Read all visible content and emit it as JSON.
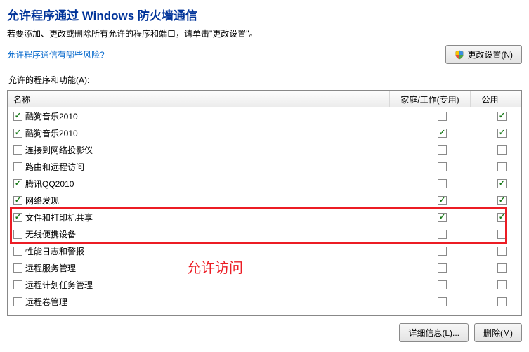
{
  "title": "允许程序通过 Windows 防火墙通信",
  "subtitle": "若要添加、更改或删除所有允许的程序和端口，请单击\"更改设置\"。",
  "risk_link": "允许程序通信有哪些风险?",
  "change_settings_btn": "更改设置(N)",
  "section_label": "允许的程序和功能(A):",
  "columns": {
    "name": "名称",
    "home": "家庭/工作(专用)",
    "public": "公用"
  },
  "rows": [
    {
      "label": "酷狗音乐2010",
      "enabled": true,
      "home": false,
      "public": true
    },
    {
      "label": "酷狗音乐2010",
      "enabled": true,
      "home": true,
      "public": true
    },
    {
      "label": "连接到网络投影仪",
      "enabled": false,
      "home": false,
      "public": false
    },
    {
      "label": "路由和远程访问",
      "enabled": false,
      "home": false,
      "public": false
    },
    {
      "label": "腾讯QQ2010",
      "enabled": true,
      "home": false,
      "public": true
    },
    {
      "label": "网络发现",
      "enabled": true,
      "home": true,
      "public": true
    },
    {
      "label": "文件和打印机共享",
      "enabled": true,
      "home": true,
      "public": true
    },
    {
      "label": "无线便携设备",
      "enabled": false,
      "home": false,
      "public": false
    },
    {
      "label": "性能日志和警报",
      "enabled": false,
      "home": false,
      "public": false
    },
    {
      "label": "远程服务管理",
      "enabled": false,
      "home": false,
      "public": false
    },
    {
      "label": "远程计划任务管理",
      "enabled": false,
      "home": false,
      "public": false
    },
    {
      "label": "远程卷管理",
      "enabled": false,
      "home": false,
      "public": false
    }
  ],
  "annotation": "允许访问",
  "details_btn": "详细信息(L)...",
  "remove_btn": "删除(M)"
}
